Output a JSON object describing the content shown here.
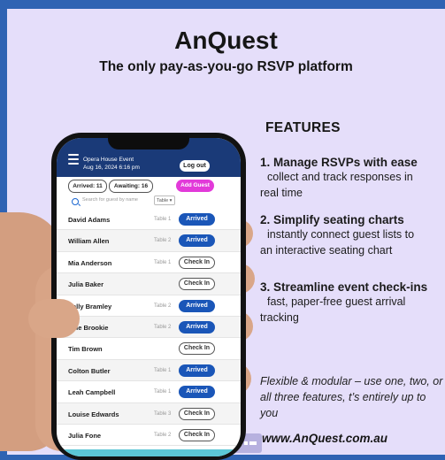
{
  "title": "AnQuest",
  "subtitle": "The only pay-as-you-go RSVP platform",
  "features_heading": "FEATURES",
  "features": [
    {
      "heading": "1. Manage RSVPs with ease",
      "lines": [
        "collect and track responses in",
        "real time"
      ]
    },
    {
      "heading": "2. Simplify seating charts",
      "lines": [
        "instantly connect guest lists to",
        "an interactive seating chart"
      ]
    },
    {
      "heading": "3. Streamline event check-ins",
      "lines": [
        "fast, paper-free guest arrival",
        "tracking"
      ]
    }
  ],
  "flexible_text": "Flexible & modular – use one, two, or all three features, t’s entirely up to you",
  "website": "www.AnQuest.com.au",
  "app": {
    "event_name": "Opera House Event",
    "event_date": "Aug 16, 2024 6:16 pm",
    "logout_label": "Log out",
    "arrived_pill": "Arrived: 11",
    "awaiting_pill": "Awaiting: 16",
    "add_guest_label": "Add Guest",
    "search_placeholder": "Search for guest by name",
    "table_filter": "Table ▾",
    "guests": [
      {
        "name": "David Adams",
        "table": "Table 1",
        "status": "Arrived"
      },
      {
        "name": "William Allen",
        "table": "Table 2",
        "status": "Arrived"
      },
      {
        "name": "Mia Anderson",
        "table": "Table 1",
        "status": "Check In"
      },
      {
        "name": "Julia Baker",
        "table": "",
        "status": "Check In"
      },
      {
        "name": "Sally Bramley",
        "table": "Table 2",
        "status": "Arrived"
      },
      {
        "name": "Ellie Brookie",
        "table": "Table 2",
        "status": "Arrived"
      },
      {
        "name": "Tim Brown",
        "table": "",
        "status": "Check In"
      },
      {
        "name": "Colton Butler",
        "table": "Table 1",
        "status": "Arrived"
      },
      {
        "name": "Leah Campbell",
        "table": "Table 1",
        "status": "Arrived"
      },
      {
        "name": "Louise Edwards",
        "table": "Table 3",
        "status": "Check In"
      },
      {
        "name": "Julia Fone",
        "table": "Table 2",
        "status": "Check In"
      }
    ]
  },
  "colors": {
    "background": "#e5defa",
    "app_header": "#1a3a78",
    "arrived": "#1a56b8",
    "add_guest": "#e23ad9"
  }
}
